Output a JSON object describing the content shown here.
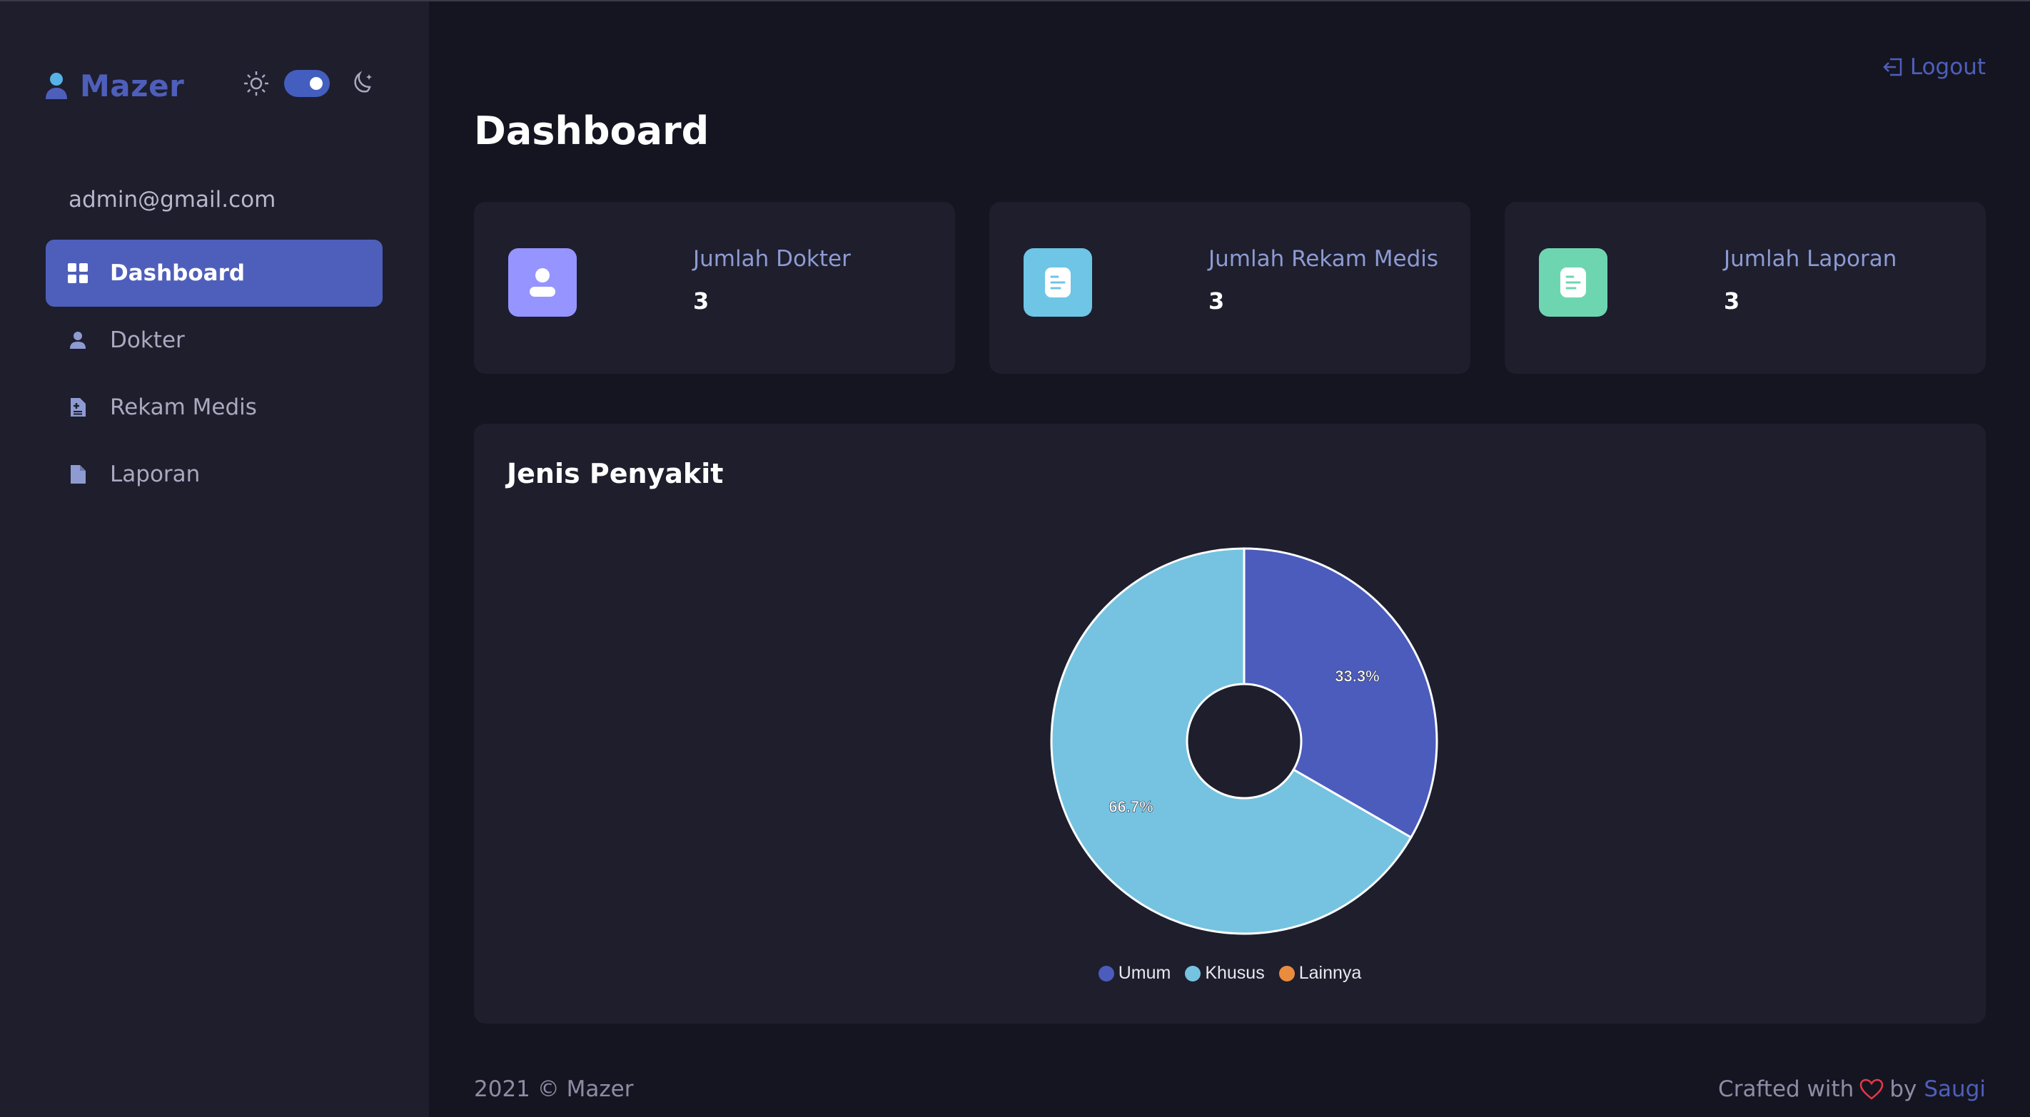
{
  "brand": {
    "name": "Mazer"
  },
  "user": {
    "email": "admin@gmail.com"
  },
  "sidebar": {
    "items": [
      {
        "label": "Dashboard",
        "icon": "grid-icon",
        "active": true
      },
      {
        "label": "Dokter",
        "icon": "person-icon",
        "active": false
      },
      {
        "label": "Rekam Medis",
        "icon": "file-medical-icon",
        "active": false
      },
      {
        "label": "Laporan",
        "icon": "file-icon",
        "active": false
      }
    ]
  },
  "header": {
    "logout_label": "Logout"
  },
  "page": {
    "title": "Dashboard"
  },
  "stats": [
    {
      "label": "Jumlah Dokter",
      "value": "3",
      "color": "#9694ff",
      "icon": "person-icon"
    },
    {
      "label": "Jumlah Rekam Medis",
      "value": "3",
      "color": "#57caeb",
      "icon": "document-icon"
    },
    {
      "label": "Jumlah Laporan",
      "value": "3",
      "color": "#5ddab4",
      "icon": "document-icon"
    }
  ],
  "chart": {
    "title": "Jenis Penyakit"
  },
  "chart_data": {
    "type": "pie",
    "variant": "donut",
    "title": "Jenis Penyakit",
    "categories": [
      "Umum",
      "Khusus",
      "Lainnya"
    ],
    "values": [
      1,
      2,
      0
    ],
    "percent_labels": [
      "33.3%",
      "66.7%",
      ""
    ],
    "colors": [
      "#4b5cbd",
      "#75c3e1",
      "#e98c3d"
    ],
    "legend_position": "bottom"
  },
  "footer": {
    "copyright": "2021 © Mazer",
    "crafted_prefix": "Crafted with",
    "crafted_by": "by",
    "author": "Saugi"
  },
  "colors": {
    "accent": "#4e5fbb",
    "background": "#151521",
    "card": "#1e1e2d"
  }
}
